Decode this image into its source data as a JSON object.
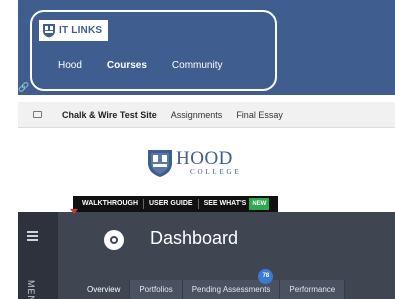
{
  "header": {
    "brand_label": "IT LINKS",
    "nav": [
      {
        "label": "Hood",
        "active": false
      },
      {
        "label": "Courses",
        "active": true
      },
      {
        "label": "Community",
        "active": false
      }
    ],
    "link_icon": "link-icon"
  },
  "subbar": {
    "site": "Chalk & Wire Test Site",
    "crumbs": [
      "Assignments",
      "Final Essay"
    ]
  },
  "logo": {
    "name": "HOOD",
    "subtitle": "COLLEGE"
  },
  "walkthrough": {
    "items": [
      "WALKTHROUGH",
      "USER GUIDE",
      "SEE WHAT'S"
    ],
    "new_badge": "NEW"
  },
  "side_menu": {
    "label": "MENU"
  },
  "dashboard": {
    "title": "Dashboard",
    "tabs": [
      {
        "label": "Overview",
        "active": true
      },
      {
        "label": "Portfolios",
        "active": false
      },
      {
        "label": "Pending Assessments",
        "active": false,
        "count": "78"
      },
      {
        "label": "Performance",
        "active": false
      }
    ]
  },
  "colors": {
    "header_blue": "#3f5d8e",
    "dashboard_dark": "#3f4652",
    "badge_green": "#2fa84f",
    "count_blue": "#3a7bd5"
  }
}
